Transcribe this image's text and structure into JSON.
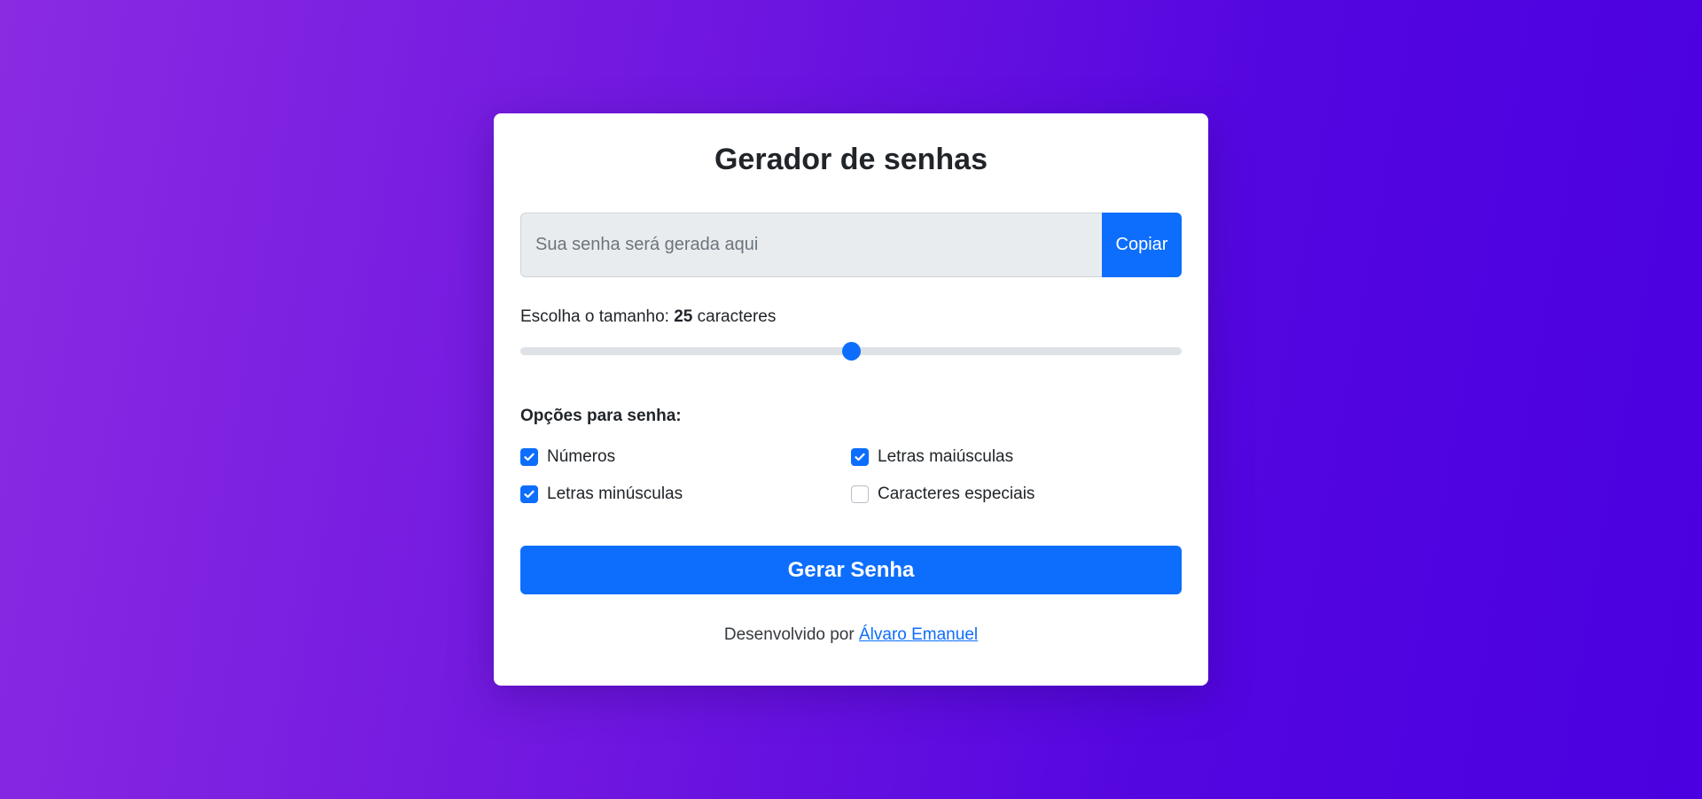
{
  "app": {
    "title": "Gerador de senhas"
  },
  "password": {
    "value": "",
    "placeholder": "Sua senha será gerada aqui",
    "copy_label": "Copiar"
  },
  "length": {
    "label_prefix": "Escolha o tamanho: ",
    "value": "25",
    "label_suffix": " caracteres",
    "min": 4,
    "max": 46,
    "current": 25
  },
  "options": {
    "title": "Opções para senha:",
    "items": [
      {
        "label": "Números",
        "checked": true,
        "icon": "check-icon"
      },
      {
        "label": "Letras maiúsculas",
        "checked": true,
        "icon": "check-icon"
      },
      {
        "label": "Letras minúsculas",
        "checked": true,
        "icon": "check-icon"
      },
      {
        "label": "Caracteres especiais",
        "checked": false,
        "icon": ""
      }
    ]
  },
  "generate": {
    "label": "Gerar Senha"
  },
  "footer": {
    "prefix": "Desenvolvido por ",
    "author": "Álvaro Emanuel"
  },
  "colors": {
    "primary": "#0d6efd",
    "background_start": "#8a2be2",
    "background_end": "#4a00e0",
    "card": "#ffffff"
  }
}
